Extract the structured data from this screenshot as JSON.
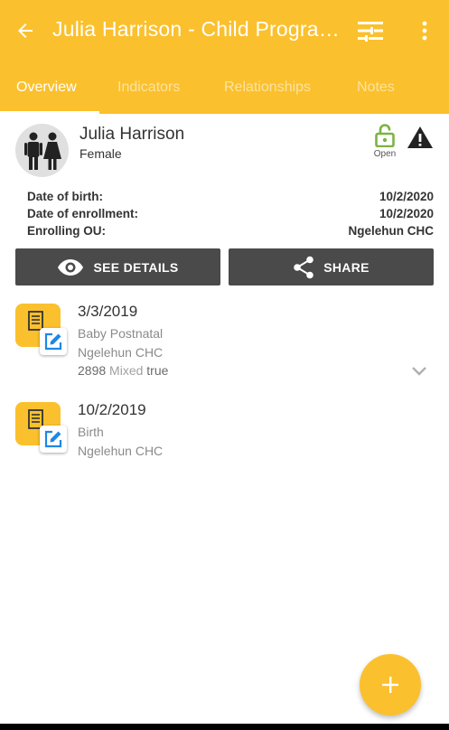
{
  "toolbar": {
    "title": "Julia Harrison - Child Programme",
    "back_icon": "arrow-back-icon",
    "filter_icon": "filter-icon",
    "more_icon": "more-vert-icon"
  },
  "tabs": [
    {
      "label": "Overview",
      "active": true
    },
    {
      "label": "Indicators",
      "active": false
    },
    {
      "label": "Relationships",
      "active": false
    },
    {
      "label": "Notes",
      "active": false
    }
  ],
  "profile": {
    "name": "Julia Harrison",
    "sex": "Female",
    "status_label": "Open",
    "status_color": "#7CB342"
  },
  "details": [
    {
      "label": "Date of birth:",
      "value": "10/2/2020"
    },
    {
      "label": "Date of enrollment:",
      "value": "10/2/2020"
    },
    {
      "label": "Enrolling OU:",
      "value": "Ngelehun CHC"
    }
  ],
  "actions": {
    "see_details": "SEE DETAILS",
    "share": "SHARE"
  },
  "events": [
    {
      "date": "3/3/2019",
      "stage": "Baby Postnatal",
      "org_unit": "Ngelehun CHC",
      "values": [
        "2898",
        "Mixed",
        "true"
      ]
    },
    {
      "date": "10/2/2019",
      "stage": "Birth",
      "org_unit": "Ngelehun CHC"
    }
  ],
  "fab": {
    "label": "+"
  },
  "colors": {
    "primary": "#FBC02D",
    "button_dark": "#4a4a4a"
  }
}
